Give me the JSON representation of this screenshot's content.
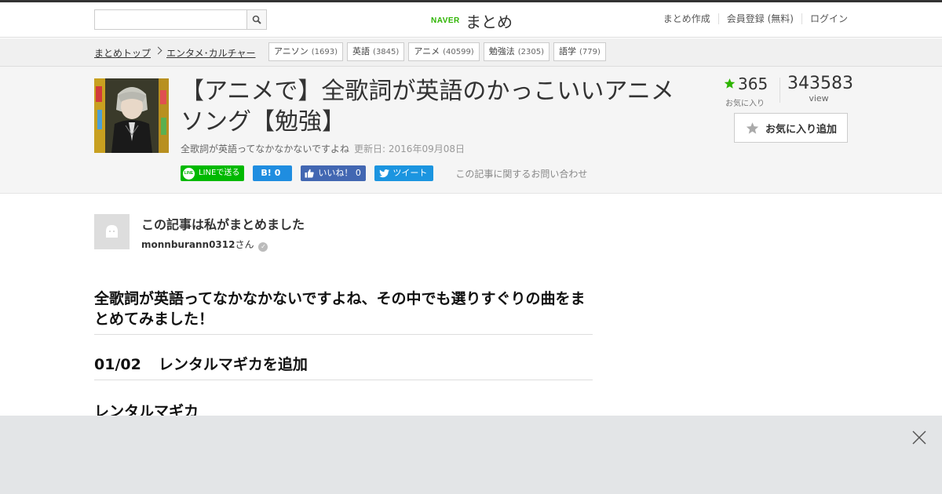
{
  "header": {
    "search_placeholder": "",
    "logo_naver": "NAVER",
    "logo_matome": "まとめ",
    "nav": [
      "まとめ作成",
      "会員登録 (無料)",
      "ログイン"
    ]
  },
  "breadcrumb": {
    "items": [
      "まとめトップ",
      "エンタメ･カルチャー"
    ]
  },
  "tags": [
    {
      "name": "アニソン",
      "count": "(1693)"
    },
    {
      "name": "英語",
      "count": "(3845)"
    },
    {
      "name": "アニメ",
      "count": "(40599)"
    },
    {
      "name": "勉強法",
      "count": "(2305)"
    },
    {
      "name": "語学",
      "count": "(779)"
    }
  ],
  "article": {
    "title": "【アニメで】全歌詞が英語のかっこいいアニメソング【勉強】",
    "description": "全歌詞が英語ってなかなかないですよね",
    "updated": "更新日: 2016年09月08日",
    "inquiry": "この記事に関するお問い合わせ"
  },
  "social": {
    "line": "LINEで送る",
    "line_icon": "LINE",
    "hatena_glyph": "B!",
    "hatena_count": "0",
    "fb_label": "いいね！",
    "fb_count": "0",
    "tweet": "ツイート"
  },
  "stats": {
    "fav_count": "365",
    "fav_label": "お気に入り",
    "view_count": "343583",
    "view_label": "view",
    "fav_button": "お気に入り追加"
  },
  "author": {
    "heading": "この記事は私がまとめました",
    "name": "monnburann0312",
    "suffix": "さん"
  },
  "content": {
    "lead": "全歌詞が英語ってなかなかないですよね、その中でも選りすぐりの曲をまとめてみました！",
    "item_date": "01/02",
    "item_text": "レンタルマギカを追加",
    "subheading": "レンタルマギカ"
  },
  "colors": {
    "line_green": "#00b900",
    "hatena_blue": "#1f8de0",
    "facebook_blue": "#4267b2",
    "twitter_blue": "#1b95e0",
    "naver_green": "#2db400",
    "star_green": "#2db400"
  }
}
